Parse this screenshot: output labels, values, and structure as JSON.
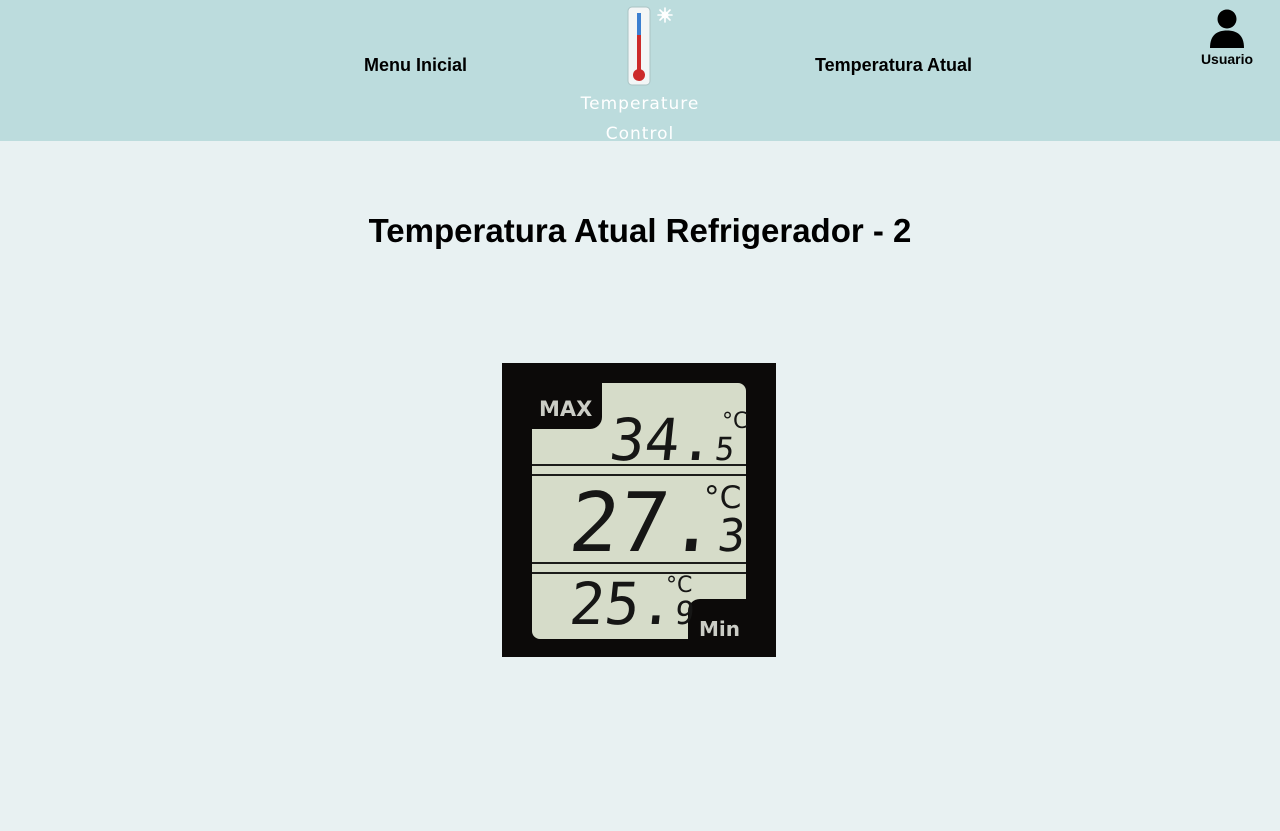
{
  "header": {
    "nav": {
      "menu_label": "Menu Inicial",
      "current_label": "Temperatura Atual"
    },
    "logo": {
      "line1": "Temperature",
      "line2": "Control",
      "icon": "thermometer-snowflake-icon"
    },
    "user": {
      "label": "Usuario",
      "icon": "user-icon"
    }
  },
  "main": {
    "title": "Temperatura Atual Refrigerador - 2",
    "thermometer": {
      "max_label": "MAX",
      "max_int": "34.",
      "max_dec": "5",
      "current_int": "27.",
      "current_dec": "3",
      "min_int": "25.",
      "min_dec": "9",
      "min_label": "Min",
      "unit": "°C"
    }
  },
  "colors": {
    "header_bg": "#bcdcdd",
    "page_bg": "#e8f1f2",
    "lcd_bg": "#d6dcc9",
    "device_frame": "#0c0a09",
    "thermo_red": "#cc2b2b",
    "thermo_blue": "#3b7fd0"
  }
}
